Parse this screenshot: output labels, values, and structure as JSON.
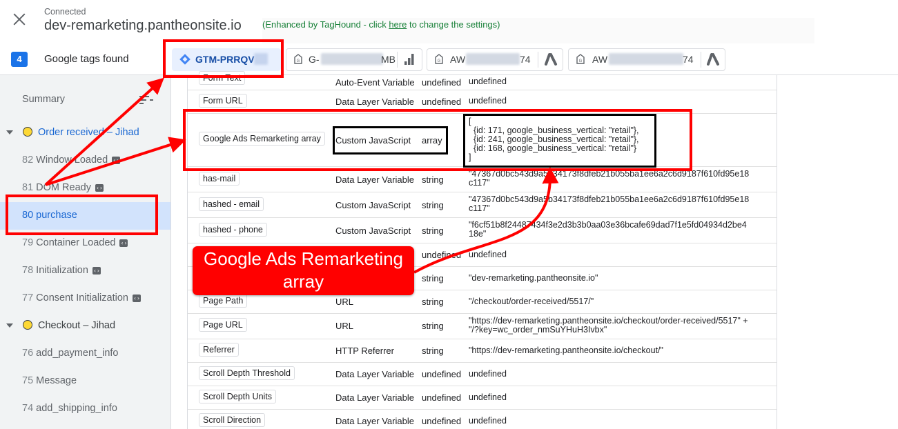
{
  "header": {
    "connection_status": "Connected",
    "site": "dev-remarketing.pantheonsite.io",
    "enhanced_prefix": "(Enhanced by TagHound - click ",
    "enhanced_link": "here",
    "enhanced_suffix": " to change the settings)"
  },
  "tagbar": {
    "count": "4",
    "label": "Google tags found",
    "chips": [
      {
        "label": "GTM-PRRQV",
        "icon": "gtm-diamond-icon",
        "active": true
      },
      {
        "label": "G-",
        "label_tail": "MB",
        "icon": "google-tag-icon",
        "secondary_icon": "analytics-bars-icon"
      },
      {
        "label": "AW",
        "label_tail": "74",
        "icon": "google-tag-icon",
        "secondary_icon": "google-ads-icon"
      },
      {
        "label": "AW",
        "label_tail": "74",
        "icon": "google-tag-icon",
        "secondary_icon": "google-ads-icon"
      }
    ]
  },
  "sidebar": {
    "summary": "Summary",
    "groups": [
      {
        "title": "Order received – Jihad",
        "items": [
          {
            "num": "82",
            "label": "Window Loaded",
            "code_icon": true
          },
          {
            "num": "81",
            "label": "DOM Ready",
            "code_icon": true
          },
          {
            "num": "80",
            "label": "purchase",
            "active": true
          },
          {
            "num": "79",
            "label": "Container Loaded",
            "code_icon": true
          },
          {
            "num": "78",
            "label": "Initialization",
            "code_icon": true
          },
          {
            "num": "77",
            "label": "Consent Initialization",
            "code_icon": true
          }
        ]
      },
      {
        "title": "Checkout – Jihad",
        "items": [
          {
            "num": "76",
            "label": "add_payment_info"
          },
          {
            "num": "75",
            "label": "Message"
          },
          {
            "num": "74",
            "label": "add_shipping_info"
          }
        ]
      }
    ]
  },
  "variables": {
    "rows": [
      {
        "name": "Form Text",
        "type": "Auto-Event Variable",
        "rtype": "undefined",
        "value": "undefined"
      },
      {
        "name": "Form URL",
        "type": "Data Layer Variable",
        "rtype": "undefined",
        "value": "undefined"
      },
      {
        "name": "Google Ads Remarketing array",
        "type": "Custom JavaScript",
        "rtype": "array",
        "value": "[\n  {id: 171, google_business_vertical: \"retail\"},\n  {id: 241, google_business_vertical: \"retail\"},\n  {id: 168, google_business_vertical: \"retail\"}\n]"
      },
      {
        "name": "has-mail",
        "type": "Data Layer Variable",
        "rtype": "string",
        "value": "\"47367d0bc543d9a5b34173f8dfeb21b055ba1ee6a2c6d9187f610fd95e18\nc117\""
      },
      {
        "name": "hashed - email",
        "type": "Custom JavaScript",
        "rtype": "string",
        "value": "\"47367d0bc543d9a5b34173f8dfeb21b055ba1ee6a2c6d9187f610fd95e18\nc117\""
      },
      {
        "name": "hashed - phone",
        "type": "Custom JavaScript",
        "rtype": "string",
        "value": "\"f6cf51b8f24487434f3e2d3b3b0aa03e36bcafe69dad7f1e5fd04934d2be4\n18e\""
      },
      {
        "name": "",
        "type": "",
        "rtype": "undefined",
        "value": "undefined"
      },
      {
        "name": "",
        "type": "",
        "rtype": "string",
        "value": "\"dev-remarketing.pantheonsite.io\""
      },
      {
        "name": "Page Path",
        "type": "URL",
        "rtype": "string",
        "value": "\"/checkout/order-received/5517/\""
      },
      {
        "name": "Page URL",
        "type": "URL",
        "rtype": "string",
        "value": "\"https://dev-remarketing.pantheonsite.io/checkout/order-received/5517\" +\n\"/?key=wc_order_nmSuYHuH3Ivbx\""
      },
      {
        "name": "Referrer",
        "type": "HTTP Referrer",
        "rtype": "string",
        "value": "\"https://dev-remarketing.pantheonsite.io/checkout/\""
      },
      {
        "name": "Scroll Depth Threshold",
        "type": "Data Layer Variable",
        "rtype": "undefined",
        "value": "undefined"
      },
      {
        "name": "Scroll Depth Units",
        "type": "Data Layer Variable",
        "rtype": "undefined",
        "value": "undefined"
      },
      {
        "name": "Scroll Direction",
        "type": "Data Layer Variable",
        "rtype": "undefined",
        "value": "undefined"
      }
    ]
  },
  "annotation": {
    "callout_text": "Google Ads Remarketing array",
    "color": "#ff0000"
  },
  "colors": {
    "accent": "#1a73e8",
    "active_bg": "#d2e3fc",
    "annotation_red": "#ff0000"
  }
}
